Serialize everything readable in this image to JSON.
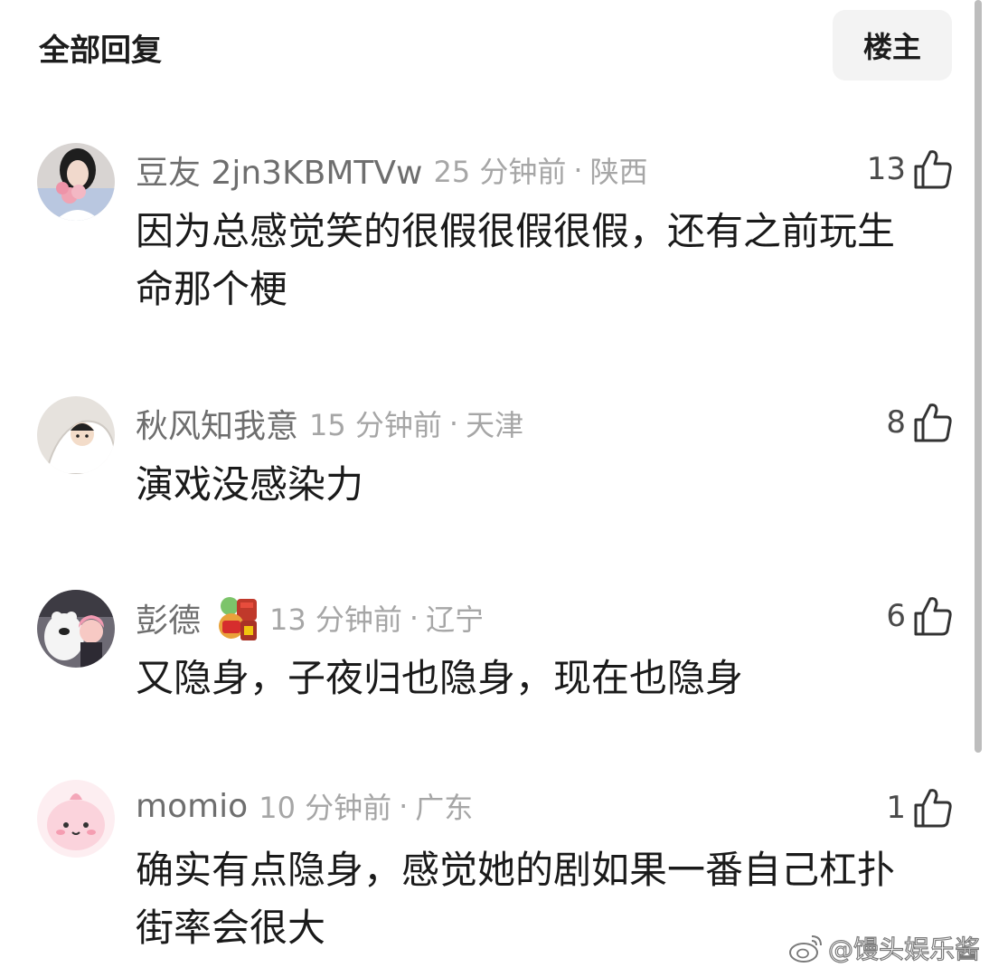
{
  "header": {
    "title": "全部回复",
    "filter_button": "楼主"
  },
  "comments": [
    {
      "username": "豆友 2jn3KBMTVw",
      "time": "25 分钟前",
      "location": "陕西",
      "likes": "13",
      "text": "因为总感觉笑的很假很假很假，还有之前玩生命那个梗"
    },
    {
      "username": "秋风知我意",
      "time": "15 分钟前",
      "location": "天津",
      "likes": "8",
      "text": "演戏没感染力"
    },
    {
      "username": "彭德",
      "time": "13 分钟前",
      "location": "辽宁",
      "likes": "6",
      "text": "又隐身，子夜归也隐身，现在也隐身"
    },
    {
      "username": "momio",
      "time": "10 分钟前",
      "location": "广东",
      "likes": "1",
      "text": "确实有点隐身，感觉她的剧如果一番自己杠扑街率会很大"
    }
  ],
  "watermark": "@馒头娱乐酱",
  "icons": {
    "like": "thumbs-up-icon",
    "watermark": "weibo-logo"
  }
}
